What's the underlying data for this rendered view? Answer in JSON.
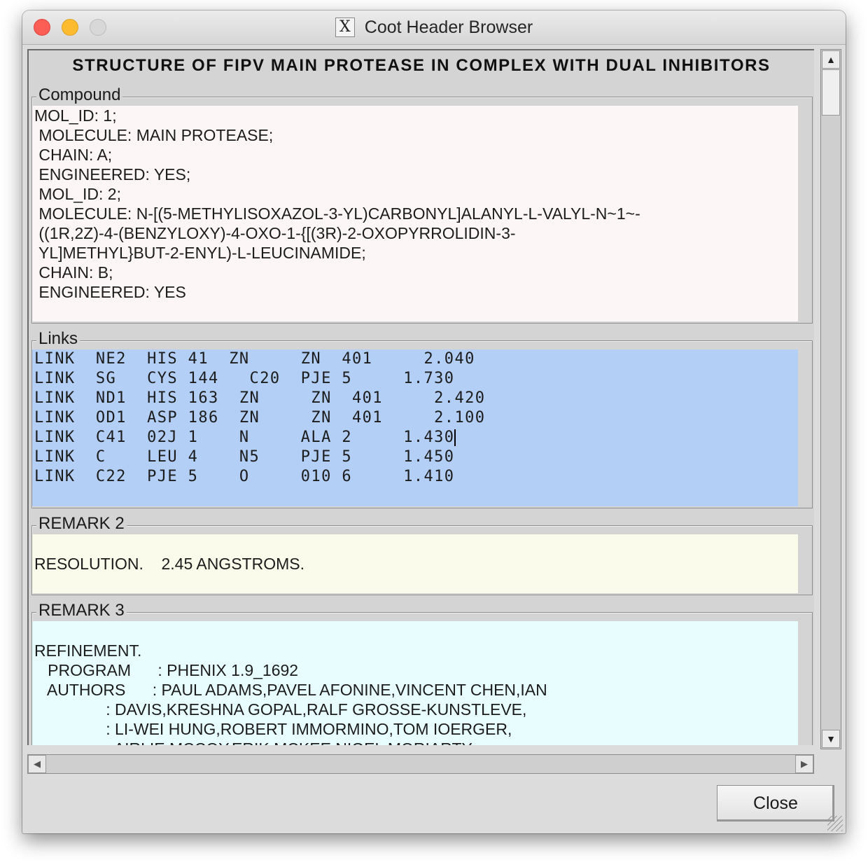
{
  "window": {
    "title": "Coot Header Browser",
    "app_icon": "X"
  },
  "header_title": "STRUCTURE OF FIPV MAIN PROTEASE IN COMPLEX WITH DUAL INHIBITORS",
  "sections": {
    "compound": {
      "label": "Compound",
      "bg": "#fcf6f6",
      "lines": [
        "MOL_ID: 1;",
        " MOLECULE: MAIN PROTEASE;",
        " CHAIN: A;",
        " ENGINEERED: YES;",
        " MOL_ID: 2;",
        " MOLECULE: N-[(5-METHYLISOXAZOL-3-YL)CARBONYL]ALANYL-L-VALYL-N~1~-",
        " ((1R,2Z)-4-(BENZYLOXY)-4-OXO-1-{[(3R)-2-OXOPYRROLIDIN-3-",
        " YL]METHYL}BUT-2-ENYL)-L-LEUCINAMIDE;",
        " CHAIN: B;",
        " ENGINEERED: YES"
      ]
    },
    "links": {
      "label": "Links",
      "bg": "#b3cff5",
      "lines": [
        "LINK  NE2  HIS 41  ZN     ZN  401     2.040",
        "LINK  SG   CYS 144   C20  PJE 5     1.730",
        "LINK  ND1  HIS 163  ZN     ZN  401     2.420",
        "LINK  OD1  ASP 186  ZN     ZN  401     2.100",
        "LINK  C41  02J 1    N     ALA 2     1.430",
        "LINK  C    LEU 4    N5    PJE 5     1.450",
        "LINK  C22  PJE 5    O     010 6     1.410"
      ]
    },
    "remark2": {
      "label": "REMARK 2",
      "bg": "#fbfbeb",
      "lines": [
        "",
        "RESOLUTION.    2.45 ANGSTROMS."
      ]
    },
    "remark3": {
      "label": "REMARK 3",
      "bg": "#e8fdfe",
      "lines": [
        "",
        "REFINEMENT.",
        "   PROGRAM      : PHENIX 1.9_1692",
        "   AUTHORS      : PAUL ADAMS,PAVEL AFONINE,VINCENT CHEN,IAN",
        "                : DAVIS,KRESHNA GOPAL,RALF GROSSE-KUNSTLEVE,",
        "                : LI-WEI HUNG,ROBERT IMMORMINO,TOM IOERGER,",
        "                : AIRLIE MCCOY,ERIK MCKEE,NIGEL MORIARTY,"
      ]
    }
  },
  "scroll": {
    "up_icon": "▲",
    "down_icon": "▼",
    "left_icon": "◀",
    "right_icon": "▶"
  },
  "buttons": {
    "close": "Close"
  }
}
